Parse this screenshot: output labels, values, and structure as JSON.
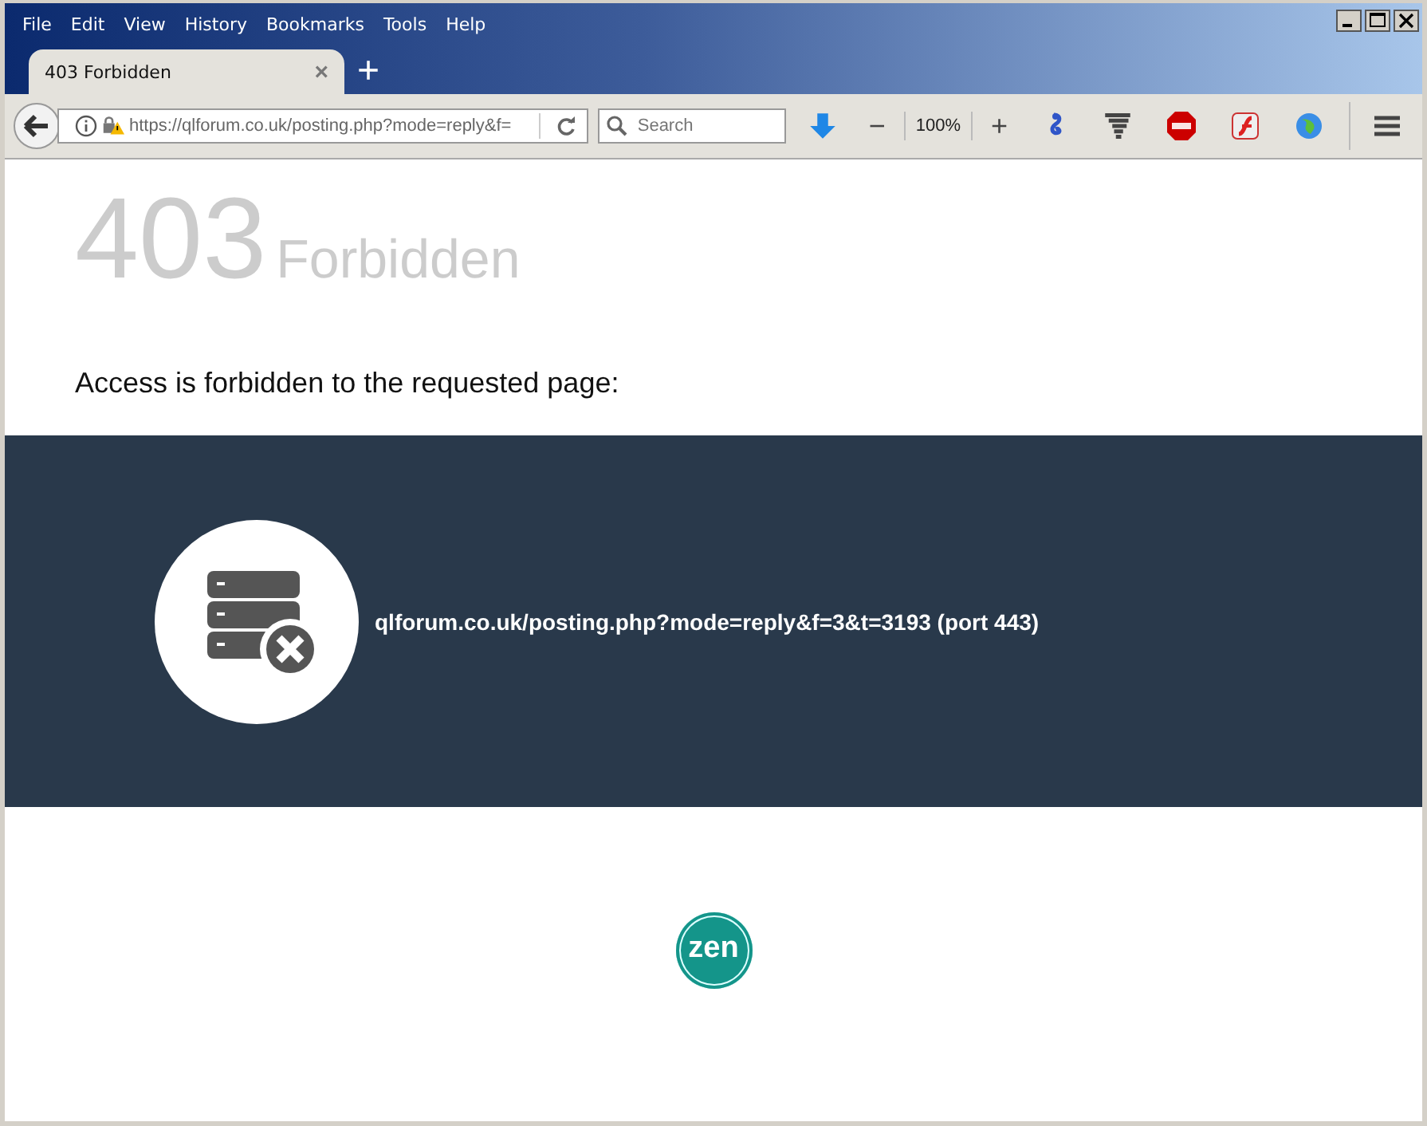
{
  "menu": [
    "File",
    "Edit",
    "View",
    "History",
    "Bookmarks",
    "Tools",
    "Help"
  ],
  "tabs": [
    {
      "label": "403 Forbidden",
      "selected": true,
      "close": "×"
    }
  ],
  "new_tab": "+",
  "address": {
    "value": "https://qlforum.co.uk/posting.php?mode=reply&f="
  },
  "search": {
    "placeholder": "Search"
  },
  "zoom": {
    "minus": "−",
    "level": "100%",
    "plus": "+"
  },
  "page": {
    "code": "403",
    "title": "Forbidden",
    "message": "Access is forbidden to the requested page:",
    "blocked_url": "qlforum.co.uk/posting.php?mode=reply&f=3&t=3193 (port 443)",
    "logo": "zen"
  }
}
